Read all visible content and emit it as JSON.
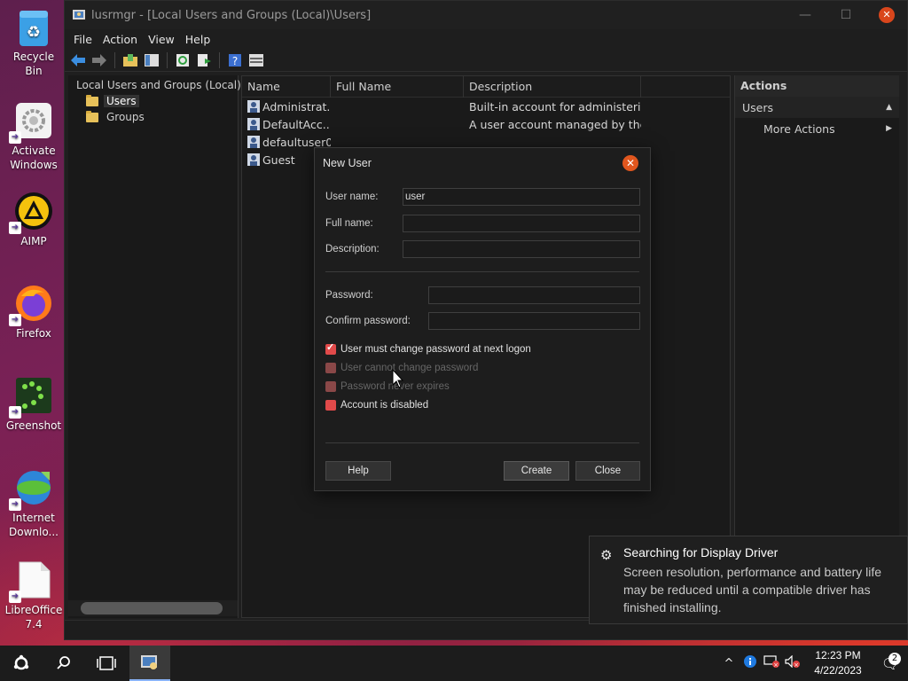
{
  "desktop": {
    "icons": [
      {
        "label": "Recycle Bin"
      },
      {
        "label": "Activate Windows"
      },
      {
        "label": "AIMP"
      },
      {
        "label": "Firefox"
      },
      {
        "label": "Greenshot"
      },
      {
        "label": "Internet Downlo..."
      },
      {
        "label": "LibreOffice 7.4"
      }
    ]
  },
  "window": {
    "title": "lusrmgr - [Local Users and Groups (Local)\\Users]",
    "menu": [
      "File",
      "Action",
      "View",
      "Help"
    ],
    "tree": {
      "root": "Local Users and Groups (Local)",
      "children": [
        "Users",
        "Groups"
      ]
    },
    "list": {
      "columns": [
        "Name",
        "Full Name",
        "Description"
      ],
      "rows": [
        {
          "name": "Administrat...",
          "full_name": "",
          "description": "Built-in account for administeri..."
        },
        {
          "name": "DefaultAcc...",
          "full_name": "",
          "description": "A user account managed by the..."
        },
        {
          "name": "defaultuser0",
          "full_name": "",
          "description": ""
        },
        {
          "name": "Guest",
          "full_name": "",
          "description": ""
        }
      ]
    },
    "actions": {
      "header": "Actions",
      "section": "Users",
      "more": "More Actions"
    }
  },
  "dialog": {
    "title": "New User",
    "username_label": "User name:",
    "username_value": "user",
    "fullname_label": "Full name:",
    "fullname_value": "",
    "description_label": "Description:",
    "description_value": "",
    "password_label": "Password:",
    "confirm_label": "Confirm password:",
    "checkboxes": {
      "must_change": {
        "label": "User must change password at next logon",
        "checked": true
      },
      "cannot_change": {
        "label": "User cannot change password",
        "checked": false,
        "disabled": true
      },
      "never_expires": {
        "label": "Password never expires",
        "checked": false,
        "disabled": true
      },
      "disabled": {
        "label": "Account is disabled",
        "checked": false
      }
    },
    "help_button": "Help",
    "create_button": "Create",
    "close_button": "Close"
  },
  "toast": {
    "title": "Searching for Display Driver",
    "body": "Screen resolution, performance and battery life may be reduced until a compatible driver has finished installing."
  },
  "taskbar": {
    "time": "12:23 PM",
    "date": "4/22/2023",
    "notification_count": "2"
  },
  "colors": {
    "accent_checkbox": "#e14a4a",
    "close_button": "#e0561e",
    "folder": "#e7c15a"
  }
}
